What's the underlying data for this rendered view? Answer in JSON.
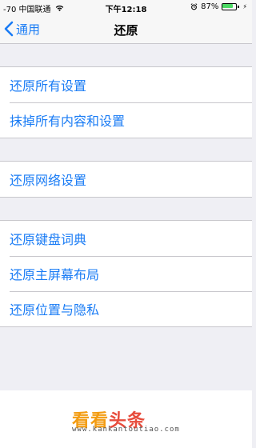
{
  "status_bar": {
    "carrier": "-70 中国联通",
    "time": "下午12:18",
    "battery_percent_label": "87%",
    "battery_level": 0.87,
    "icons": [
      "wifi-icon",
      "alarm-icon",
      "battery-icon",
      "bolt-icon"
    ]
  },
  "nav": {
    "back_label": "通用",
    "title": "还原"
  },
  "groups": [
    [
      "还原所有设置",
      "抹掉所有内容和设置"
    ],
    [
      "还原网络设置"
    ],
    [
      "还原键盘词典",
      "还原主屏幕布局",
      "还原位置与隐私"
    ]
  ],
  "watermark": {
    "logo_part1": "看看",
    "logo_part2": "头条",
    "url": "www.kankantoutiao.com"
  },
  "colors": {
    "accent": "#1a7cf5",
    "background": "#efeff4",
    "battery_green": "#4cd964"
  }
}
